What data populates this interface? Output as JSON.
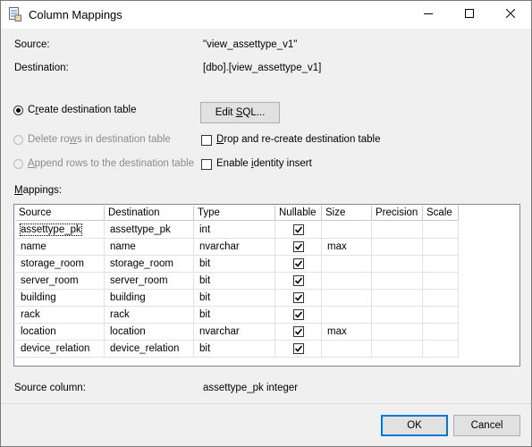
{
  "window": {
    "title": "Column Mappings",
    "icon": "table-mapping-icon",
    "minimize_icon": "minimize-icon",
    "maximize_icon": "maximize-icon",
    "close_icon": "close-icon"
  },
  "info": {
    "source_label": "Source:",
    "source_value": "\"view_assettype_v1\"",
    "destination_label": "Destination:",
    "destination_value": "[dbo].[view_assettype_v1]"
  },
  "options": {
    "create_label": "Create destination table",
    "create_selected": true,
    "delete_label": "Delete rows in destination table",
    "delete_enabled": false,
    "append_label": "Append rows to the destination table",
    "append_enabled": false,
    "edit_sql_label": "Edit SQL...",
    "drop_recreate_label": "Drop and re-create destination table",
    "drop_recreate_checked": false,
    "identity_insert_label": "Enable identity insert",
    "identity_insert_checked": false
  },
  "mappings": {
    "label": "Mappings:",
    "columns": [
      "Source",
      "Destination",
      "Type",
      "Nullable",
      "Size",
      "Precision",
      "Scale"
    ],
    "rows": [
      {
        "source": "assettype_pk",
        "destination": "assettype_pk",
        "type": "int",
        "nullable": true,
        "size": "",
        "precision": "",
        "scale": ""
      },
      {
        "source": "name",
        "destination": "name",
        "type": "nvarchar",
        "nullable": true,
        "size": "max",
        "precision": "",
        "scale": ""
      },
      {
        "source": "storage_room",
        "destination": "storage_room",
        "type": "bit",
        "nullable": true,
        "size": "",
        "precision": "",
        "scale": ""
      },
      {
        "source": "server_room",
        "destination": "server_room",
        "type": "bit",
        "nullable": true,
        "size": "",
        "precision": "",
        "scale": ""
      },
      {
        "source": "building",
        "destination": "building",
        "type": "bit",
        "nullable": true,
        "size": "",
        "precision": "",
        "scale": ""
      },
      {
        "source": "rack",
        "destination": "rack",
        "type": "bit",
        "nullable": true,
        "size": "",
        "precision": "",
        "scale": ""
      },
      {
        "source": "location",
        "destination": "location",
        "type": "nvarchar",
        "nullable": true,
        "size": "max",
        "precision": "",
        "scale": ""
      },
      {
        "source": "device_relation",
        "destination": "device_relation",
        "type": "bit",
        "nullable": true,
        "size": "",
        "precision": "",
        "scale": ""
      }
    ]
  },
  "source_column": {
    "label": "Source column:",
    "value": "assettype_pk integer"
  },
  "buttons": {
    "ok": "OK",
    "cancel": "Cancel"
  }
}
